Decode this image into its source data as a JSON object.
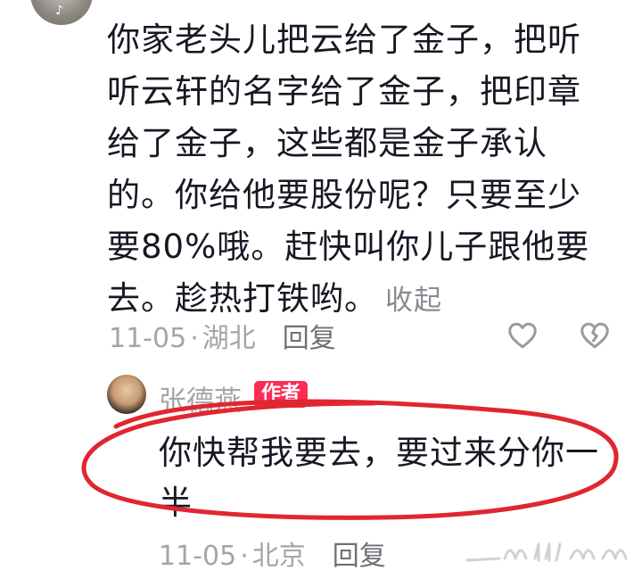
{
  "comment": {
    "lines": [
      "你家老头儿把云给了金子，把听",
      "听云轩的名字给了金子，把印章",
      "给了金子，这些都是金子承认",
      "的。你给他要股份呢？只要至少",
      "要80%哦。赶快叫你儿子跟他要",
      "去。趁热打铁哟。"
    ],
    "collapse_label": "收起",
    "date": "11-05",
    "location": "湖北",
    "reply_label": "回复",
    "icons": {
      "like": "heart-outline-icon",
      "dislike": "broken-heart-outline-icon"
    }
  },
  "reply": {
    "author": "张德燕",
    "author_badge": "作者",
    "lines": [
      "你快帮我要去，要过来分你一",
      "半"
    ],
    "date": "11-05",
    "location": "北京",
    "reply_label": "回复"
  },
  "annotation": {
    "color": "#e0262f"
  },
  "colors": {
    "text": "#161823",
    "meta": "#a4a5aa",
    "badge": "#fe2c55"
  }
}
